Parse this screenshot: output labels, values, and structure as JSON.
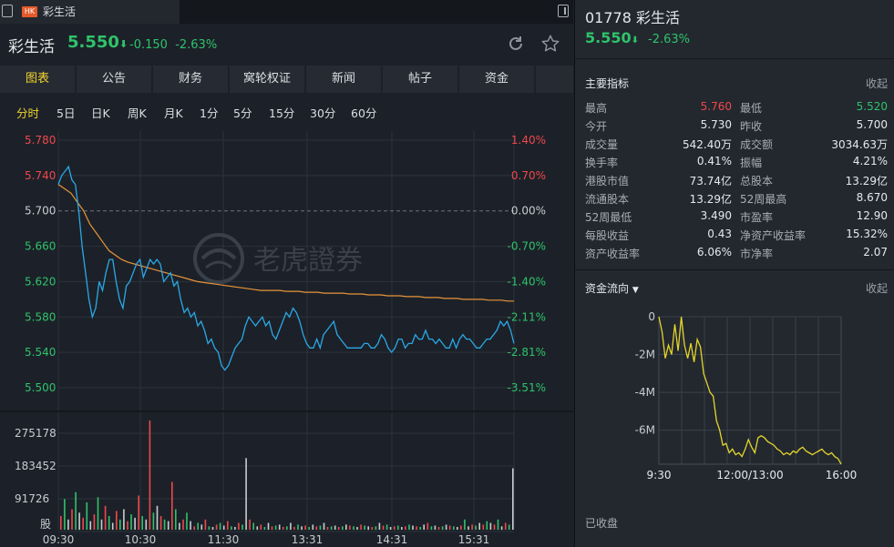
{
  "tab": {
    "badge": "HK",
    "title": "彩生活"
  },
  "header": {
    "name": "彩生活",
    "price": "5.550",
    "arrow": "⬇",
    "change": "-0.150",
    "change_pct": "-2.63%"
  },
  "nav": {
    "tabs": [
      "图表",
      "公告",
      "财务",
      "窝轮权证",
      "新闻",
      "帖子",
      "资金"
    ],
    "active": 0
  },
  "periods": {
    "items": [
      "分时",
      "5日",
      "日K",
      "周K",
      "月K",
      "1分",
      "5分",
      "15分",
      "30分",
      "60分"
    ],
    "active": 0
  },
  "watermark": "老虎證券",
  "colors": {
    "up": "#f0474a",
    "down": "#2fc36a",
    "price_line": "#2aa8e6",
    "avg_line": "#e8943a",
    "accent": "#f2d32f",
    "flow_line": "#e4d52b"
  },
  "chart_data": [
    {
      "type": "line",
      "title": "",
      "y_left_ticks": [
        "5.780",
        "5.740",
        "5.700",
        "5.660",
        "5.620",
        "5.580",
        "5.540",
        "5.500"
      ],
      "y_right_ticks": [
        "1.40%",
        "0.70%",
        "0.00%",
        "-0.70%",
        "-1.40%",
        "-2.11%",
        "-2.81%",
        "-3.51%"
      ],
      "ylim": [
        5.5,
        5.78
      ],
      "prev_close": 5.7,
      "x_ticks": [
        "09:30",
        "10:30",
        "11:30",
        "13:31",
        "14:31",
        "15:31"
      ],
      "series": [
        {
          "values": [
            5.73,
            5.74,
            5.745,
            5.75,
            5.735,
            5.73,
            5.7,
            5.66,
            5.63,
            5.6,
            5.58,
            5.59,
            5.62,
            5.61,
            5.63,
            5.645,
            5.645,
            5.62,
            5.6,
            5.59,
            5.615,
            5.62,
            5.63,
            5.64,
            5.645,
            5.625,
            5.635,
            5.645,
            5.64,
            5.645,
            5.64,
            5.62,
            5.625,
            5.63,
            5.615,
            5.62,
            5.6,
            5.585,
            5.59,
            5.58,
            5.585,
            5.57,
            5.575,
            5.565,
            5.55,
            5.555,
            5.545,
            5.54,
            5.525,
            5.52,
            5.525,
            5.535,
            5.545,
            5.55,
            5.555,
            5.57,
            5.58,
            5.575,
            5.57,
            5.575,
            5.58,
            5.57,
            5.575,
            5.56,
            5.555,
            5.565,
            5.575,
            5.585,
            5.58,
            5.59,
            5.585,
            5.575,
            5.56,
            5.55,
            5.545,
            5.545,
            5.555,
            5.545,
            5.56,
            5.565,
            5.57,
            5.575,
            5.56,
            5.555,
            5.55,
            5.545,
            5.545,
            5.545,
            5.545,
            5.545,
            5.55,
            5.55,
            5.545,
            5.545,
            5.55,
            5.56,
            5.555,
            5.545,
            5.54,
            5.545,
            5.555,
            5.555,
            5.545,
            5.55,
            5.55,
            5.56,
            5.555,
            5.555,
            5.565,
            5.555,
            5.555,
            5.55,
            5.555,
            5.55,
            5.545,
            5.545,
            5.555,
            5.545,
            5.555,
            5.56,
            5.555,
            5.555,
            5.55,
            5.545,
            5.545,
            5.55,
            5.555,
            5.555,
            5.56,
            5.565,
            5.575,
            5.57,
            5.575,
            5.565,
            5.55
          ]
        },
        {
          "values": [
            5.73,
            5.725,
            5.72,
            5.71,
            5.7,
            5.685,
            5.675,
            5.665,
            5.655,
            5.65,
            5.645,
            5.642,
            5.64,
            5.638,
            5.636,
            5.634,
            5.632,
            5.63,
            5.628,
            5.626,
            5.624,
            5.622,
            5.62,
            5.619,
            5.618,
            5.617,
            5.616,
            5.615,
            5.614,
            5.613,
            5.612,
            5.611,
            5.61,
            5.61,
            5.61,
            5.61,
            5.609,
            5.609,
            5.609,
            5.608,
            5.608,
            5.608,
            5.607,
            5.607,
            5.607,
            5.607,
            5.606,
            5.606,
            5.606,
            5.605,
            5.605,
            5.605,
            5.604,
            5.604,
            5.604,
            5.603,
            5.603,
            5.603,
            5.602,
            5.602,
            5.602,
            5.601,
            5.601,
            5.601,
            5.6,
            5.6,
            5.6,
            5.6,
            5.599,
            5.599,
            5.599,
            5.598,
            5.598
          ]
        }
      ]
    },
    {
      "type": "bar",
      "title": "",
      "y_ticks": [
        "275178",
        "183452",
        "91726"
      ],
      "unit": "股",
      "ylim": [
        0,
        320000
      ],
      "values": [
        40000,
        90000,
        30000,
        60000,
        110000,
        50000,
        35000,
        80000,
        25000,
        45000,
        95000,
        30000,
        70000,
        40000,
        20000,
        55000,
        30000,
        60000,
        25000,
        45000,
        35000,
        100000,
        40000,
        30000,
        320000,
        50000,
        70000,
        40000,
        30000,
        25000,
        140000,
        60000,
        20000,
        30000,
        50000,
        25000,
        10000,
        20000,
        15000,
        30000,
        10000,
        8000,
        15000,
        20000,
        12000,
        25000,
        10000,
        8000,
        20000,
        15000,
        210000,
        30000,
        20000,
        10000,
        15000,
        8000,
        20000,
        10000,
        12000,
        15000,
        8000,
        10000,
        20000,
        8000,
        15000,
        10000,
        12000,
        8000,
        15000,
        10000,
        12000,
        20000,
        8000,
        10000,
        12000,
        8000,
        10000,
        15000,
        12000,
        10000,
        8000,
        15000,
        12000,
        10000,
        8000,
        10000,
        20000,
        12000,
        15000,
        8000,
        10000,
        12000,
        8000,
        10000,
        15000,
        12000,
        10000,
        8000,
        15000,
        20000,
        10000,
        12000,
        8000,
        10000,
        15000,
        12000,
        10000,
        8000,
        12000,
        30000,
        10000,
        15000,
        12000,
        20000,
        15000,
        25000,
        20000,
        15000,
        30000,
        10000,
        20000,
        15000,
        180000
      ]
    },
    {
      "type": "line",
      "title": "资金流向",
      "y_ticks": [
        "0",
        "-2M",
        "-4M",
        "-6M"
      ],
      "x_ticks": [
        "9:30",
        "12:00/13:00",
        "16:00"
      ],
      "ylim": [
        -7.8,
        0
      ],
      "values": [
        0,
        -0.8,
        -2.2,
        -1.5,
        -2.0,
        -0.4,
        -1.8,
        0,
        -1.5,
        -2.2,
        -1.4,
        -2.4,
        -1.2,
        -1.6,
        -3.0,
        -3.5,
        -4.0,
        -4.2,
        -5.5,
        -6.0,
        -6.8,
        -6.7,
        -7.2,
        -7.0,
        -7.3,
        -7.2,
        -7.4,
        -7.0,
        -6.5,
        -6.9,
        -7.2,
        -6.4,
        -6.3,
        -6.4,
        -6.6,
        -6.7,
        -6.8,
        -7.0,
        -7.1,
        -7.3,
        -7.2,
        -7.3,
        -7.1,
        -7.2,
        -7.0,
        -6.9,
        -7.1,
        -7.2,
        -7.3,
        -7.2,
        -7.1,
        -7.0,
        -7.2,
        -7.3,
        -7.2,
        -7.4,
        -7.5,
        -7.8
      ]
    }
  ],
  "side": {
    "title": "01778 彩生活",
    "price": "5.550",
    "arrow": "⬇",
    "change": "-2.63%",
    "metrics_title": "主要指标",
    "collapse": "收起",
    "metrics": [
      {
        "l1": "最高",
        "v1": "5.760",
        "c1": "up",
        "l2": "最低",
        "v2": "5.520",
        "c2": "down"
      },
      {
        "l1": "今开",
        "v1": "5.730",
        "c1": "",
        "l2": "昨收",
        "v2": "5.700",
        "c2": ""
      },
      {
        "l1": "成交量",
        "v1": "542.40万",
        "c1": "",
        "l2": "成交额",
        "v2": "3034.63万",
        "c2": ""
      },
      {
        "l1": "换手率",
        "v1": "0.41%",
        "c1": "",
        "l2": "振幅",
        "v2": "4.21%",
        "c2": ""
      },
      {
        "l1": "港股市值",
        "v1": "73.74亿",
        "c1": "",
        "l2": "总股本",
        "v2": "13.29亿",
        "c2": ""
      },
      {
        "l1": "流通股本",
        "v1": "13.29亿",
        "c1": "",
        "l2": "52周最高",
        "v2": "8.670",
        "c2": ""
      },
      {
        "l1": "52周最低",
        "v1": "3.490",
        "c1": "",
        "l2": "市盈率",
        "v2": "12.90",
        "c2": ""
      },
      {
        "l1": "每股收益",
        "v1": "0.43",
        "c1": "",
        "l2": "净资产收益率",
        "v2": "15.32%",
        "c2": ""
      },
      {
        "l1": "资产收益率",
        "v1": "6.06%",
        "c1": "",
        "l2": "市净率",
        "v2": "2.07",
        "c2": ""
      }
    ],
    "flow_title": "资金流向",
    "flow_collapse": "收起",
    "closed": "已收盘"
  }
}
